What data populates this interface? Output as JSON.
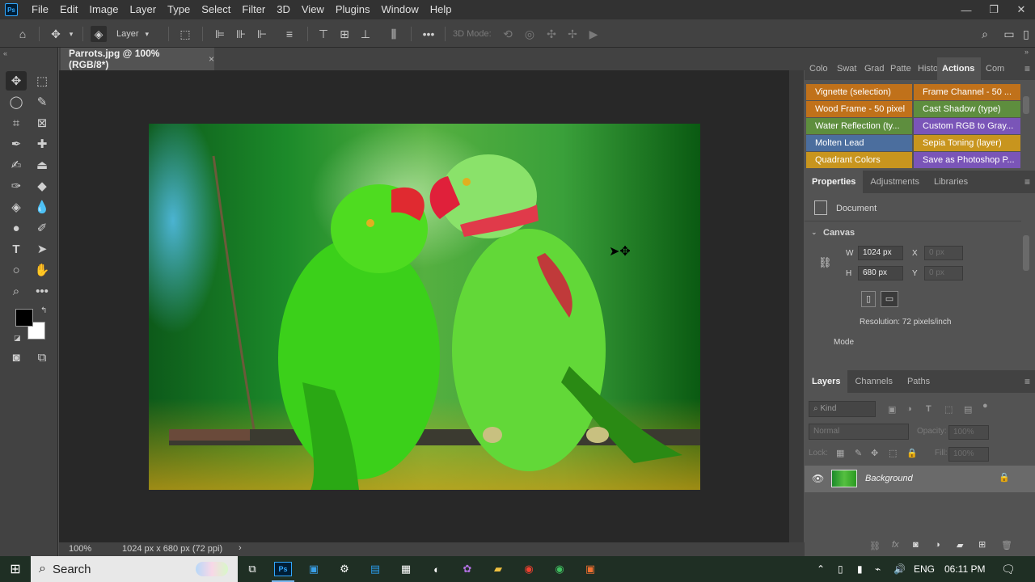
{
  "app": {
    "logo_text": "Ps",
    "menu": [
      "File",
      "Edit",
      "Image",
      "Layer",
      "Type",
      "Select",
      "Filter",
      "3D",
      "View",
      "Plugins",
      "Window",
      "Help"
    ],
    "window_controls": [
      "—",
      "❐",
      "✕"
    ]
  },
  "options_bar": {
    "layer_select": "Layer",
    "mode_3d": "3D Mode:"
  },
  "document": {
    "tab_title": "Parrots.jpg @ 100% (RGB/8*)",
    "tab_close": "×",
    "zoom": "100%",
    "dimensions": "1024 px x 680 px (72 ppi)",
    "status_arrow": "›"
  },
  "panels": {
    "top_tabs": [
      "Colo",
      "Swat",
      "Grad",
      "Patte",
      "Histo",
      "Actions",
      "Com"
    ],
    "actions": [
      {
        "label": "Vignette (selection)",
        "color": "#c0711a"
      },
      {
        "label": "Frame Channel - 50 ...",
        "color": "#c0711a"
      },
      {
        "label": "Wood Frame - 50 pixel",
        "color": "#c0711a"
      },
      {
        "label": "Cast Shadow (type)",
        "color": "#5e8e3e"
      },
      {
        "label": "Water Reflection (ty...",
        "color": "#5e8e3e"
      },
      {
        "label": "Custom RGB to Gray...",
        "color": "#7a55b8"
      },
      {
        "label": "Molten Lead",
        "color": "#4b6e9e"
      },
      {
        "label": "Sepia Toning (layer)",
        "color": "#c8951e"
      },
      {
        "label": "Quadrant Colors",
        "color": "#c8951e"
      },
      {
        "label": "Save as Photoshop P...",
        "color": "#7a55b8"
      }
    ],
    "mid_tabs": [
      "Properties",
      "Adjustments",
      "Libraries"
    ],
    "properties": {
      "document_label": "Document",
      "canvas_label": "Canvas",
      "w_label": "W",
      "w_value": "1024 px",
      "h_label": "H",
      "h_value": "680 px",
      "x_label": "X",
      "x_value": "0 px",
      "y_label": "Y",
      "y_value": "0 px",
      "resolution": "Resolution: 72 pixels/inch",
      "mode_label": "Mode"
    },
    "layer_tabs": [
      "Layers",
      "Channels",
      "Paths"
    ],
    "layers": {
      "kind_placeholder": "Kind",
      "blend_mode": "Normal",
      "opacity_label": "Opacity:",
      "opacity_value": "100%",
      "lock_label": "Lock:",
      "fill_label": "Fill:",
      "fill_value": "100%",
      "layer_name": "Background"
    }
  },
  "taskbar": {
    "search_placeholder": "Search",
    "language": "ENG",
    "time": "06:11 PM"
  }
}
